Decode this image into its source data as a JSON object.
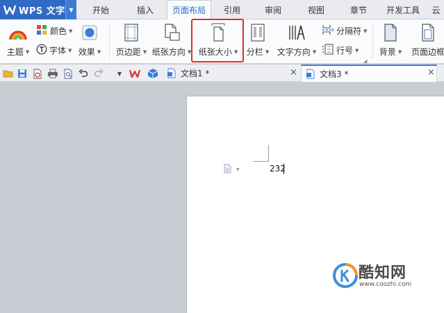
{
  "app": {
    "name": "WPS 文字"
  },
  "menu_tabs": [
    {
      "label": "开始"
    },
    {
      "label": "插入"
    },
    {
      "label": "页面布局"
    },
    {
      "label": "引用"
    },
    {
      "label": "审阅"
    },
    {
      "label": "视图"
    },
    {
      "label": "章节"
    },
    {
      "label": "开发工具"
    },
    {
      "label": "云"
    }
  ],
  "ribbon": {
    "color": "颜色",
    "theme": "主题",
    "font": "字体",
    "effect": "效果",
    "margins": "页边距",
    "orientation": "纸张方向",
    "paper_size": "纸张大小",
    "columns": "分栏",
    "text_direction": "文字方向",
    "separator": "分隔符",
    "line_number": "行号",
    "background": "背景",
    "page_border": "页面边框"
  },
  "doc_tabs": [
    {
      "label": "文档1 *"
    },
    {
      "label": "文档3 *"
    }
  ],
  "document": {
    "content": "232"
  },
  "watermark": {
    "name": "酷知网",
    "url": "www.coozhi.com"
  },
  "colors": {
    "app_blue": "#2f6bc4",
    "active_tab_text": "#2b6cc4",
    "highlight_red": "#d9302c"
  }
}
